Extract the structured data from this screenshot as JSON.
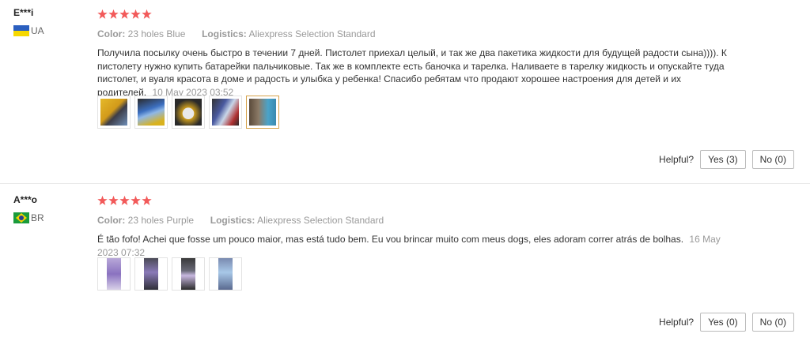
{
  "reviews": [
    {
      "user": "E***i",
      "country": "UA",
      "stars": 5,
      "color_label": "Color:",
      "color_value": "23 holes Blue",
      "logistics_label": "Logistics:",
      "logistics_value": "Aliexpress Selection Standard",
      "text": "Получила посылку очень быстро в течении 7 дней. Пистолет приехал целый, и так же два пакетика жидкости для будущей радости сына)))). К пистолету нужно купить батарейки пальчиковые. Так же в комплекте есть баночка и тарелка. Наливаете в тарелку жидкость и опускайте туда пистолет, и вуаля красота в доме и радость и улыбка у ребенка! Спасибо ребятам что продают хорошее настроения для детей и их родителей.",
      "date": "10 May 2023 03:52",
      "photos": 5,
      "helpful_label": "Helpful?",
      "yes_label": "Yes (3)",
      "no_label": "No (0)"
    },
    {
      "user": "A***o",
      "country": "BR",
      "stars": 5,
      "color_label": "Color:",
      "color_value": "23 holes Purple",
      "logistics_label": "Logistics:",
      "logistics_value": "Aliexpress Selection Standard",
      "text": "É tão fofo! Achei que fosse um pouco maior, mas está tudo bem. Eu vou brincar muito com meus dogs, eles adoram correr atrás de bolhas.",
      "date": "16 May 2023 07:32",
      "photos": 4,
      "helpful_label": "Helpful?",
      "yes_label": "Yes (0)",
      "no_label": "No (0)"
    }
  ],
  "colors": {
    "star": "#f25a5a",
    "meta_gray": "#999999",
    "active_thumb_border": "#d6a24a"
  }
}
